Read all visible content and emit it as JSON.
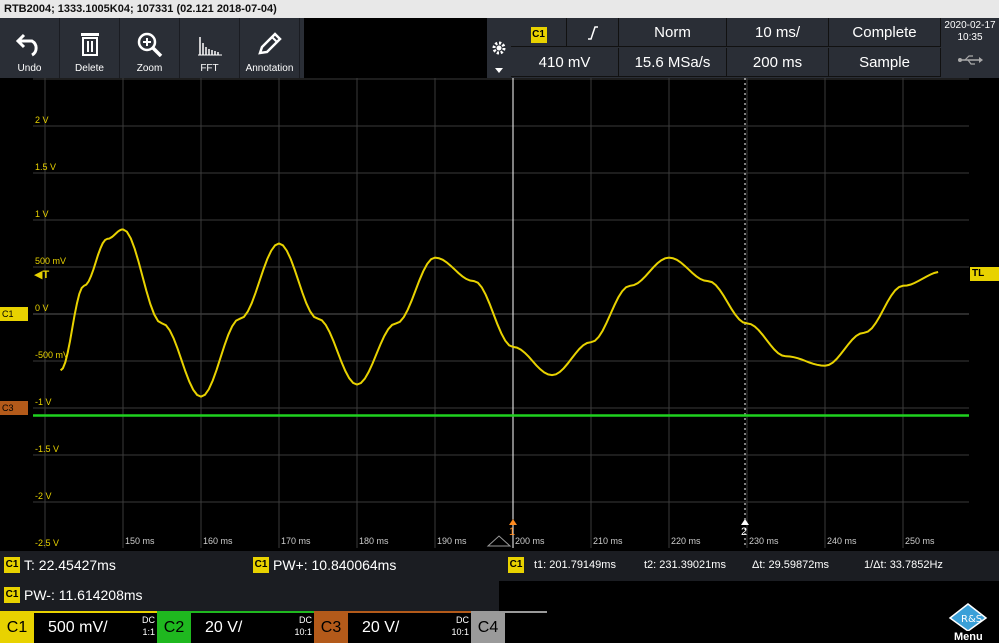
{
  "title_bar": "RTB2004; 1333.1005K04; 107331 (02.121 2018-07-04)",
  "toolbar": [
    {
      "label": "Undo",
      "icon": "undo-icon"
    },
    {
      "label": "Delete",
      "icon": "trash-icon"
    },
    {
      "label": "Zoom",
      "icon": "zoom-icon"
    },
    {
      "label": "FFT",
      "icon": "fft-icon"
    },
    {
      "label": "Annotation",
      "icon": "pen-icon"
    }
  ],
  "trigger": {
    "source": "C1",
    "slope_icon": "rising-edge-icon",
    "mode": "Norm",
    "timebase": "10 ms/",
    "acq_state": "Complete",
    "level": "410 mV",
    "sample_rate": "15.6 MSa/s",
    "record_time": "200 ms",
    "acq_mode": "Sample"
  },
  "date": "2020-02-17",
  "time": "10:35",
  "y_axis_labels": [
    "2 V",
    "1.5 V",
    "1 V",
    "500 mV",
    "0 V",
    "-500 mV",
    "-1 V",
    "-1.5 V",
    "-2 V",
    "-2.5 V"
  ],
  "x_axis_labels": [
    "150 ms",
    "160 ms",
    "170 ms",
    "180 ms",
    "190 ms",
    "200 ms",
    "210 ms",
    "220 ms",
    "230 ms",
    "240 ms",
    "250 ms"
  ],
  "markers": {
    "c1": "C1",
    "c3": "C3",
    "trigger_level": "T",
    "trigger_tag": "TL",
    "cursor1": "1",
    "cursor2": "2"
  },
  "measurements": {
    "period": "T: 22.45427ms",
    "pw_pos": "PW+: 10.840064ms",
    "pw_neg": "PW-: 11.614208ms",
    "chip": "C1"
  },
  "cursor_readout": {
    "chip": "C1",
    "t1": "t1: 201.79149ms",
    "t2": "t2: 231.39021ms",
    "dt": "Δt: 29.59872ms",
    "inv_dt": "1/Δt: 33.7852Hz"
  },
  "channels": [
    {
      "name": "C1",
      "scale": "500 mV/",
      "coupling": "DC",
      "ratio": "1:1",
      "color": "#e8d200",
      "text": "#000"
    },
    {
      "name": "C2",
      "scale": "20 V/",
      "coupling": "DC",
      "ratio": "10:1",
      "color": "#1fb81f",
      "text": "#000"
    },
    {
      "name": "C3",
      "scale": "20 V/",
      "coupling": "DC",
      "ratio": "10:1",
      "color": "#b35a1a",
      "text": "#000"
    },
    {
      "name": "C4",
      "scale": "",
      "coupling": "",
      "ratio": "",
      "color": "#9a9a9a",
      "text": "#000"
    }
  ],
  "menu_label": "Menu",
  "colors": {
    "c1": "#e8d200",
    "c3": "#1fd11f",
    "grid": "#3a3a3a",
    "panel": "#2a2e36"
  },
  "waveform_c1": {
    "unit": "V",
    "t_ms": [
      142,
      145,
      148,
      150,
      155,
      160,
      165,
      170,
      175,
      180,
      185,
      190,
      195,
      200,
      205,
      210,
      215,
      220,
      225,
      230,
      235,
      240,
      245,
      250,
      255
    ],
    "v": [
      -0.6,
      0.3,
      0.8,
      0.9,
      -0.1,
      -0.88,
      -0.05,
      0.75,
      -0.05,
      -0.75,
      -0.1,
      0.6,
      0.35,
      -0.35,
      -0.65,
      -0.3,
      0.3,
      0.6,
      0.35,
      -0.1,
      -0.45,
      -0.55,
      -0.2,
      0.3,
      0.45
    ]
  },
  "waveform_c3": {
    "level_v": -1.08
  }
}
